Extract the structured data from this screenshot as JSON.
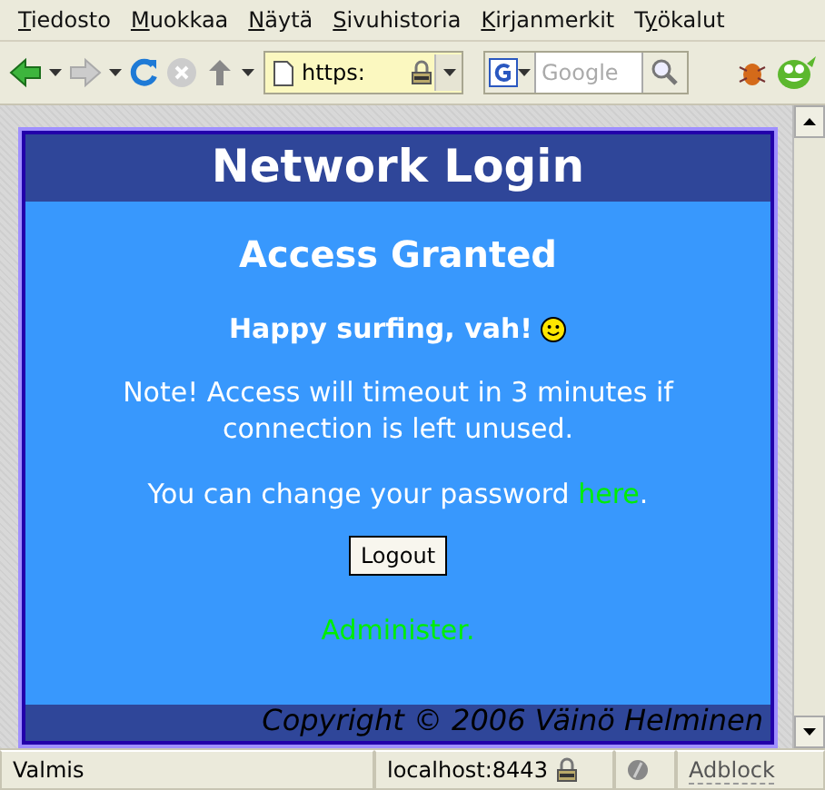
{
  "menu": [
    {
      "underlined": "T",
      "after": "iedosto"
    },
    {
      "underlined": "M",
      "after": "uokkaa"
    },
    {
      "underlined": "N",
      "after": "äytä"
    },
    {
      "underlined": "S",
      "after": "ivuhistoria"
    },
    {
      "underlined": "K",
      "after": "irjanmerkit"
    },
    {
      "before": "T",
      "underlined": "y",
      "after": "ökalut"
    }
  ],
  "toolbar": {
    "address": "https:",
    "search_placeholder": "Google"
  },
  "page": {
    "title": "Network Login",
    "heading": "Access Granted",
    "greeting": "Happy surfing, vah!",
    "note": "Note! Access will timeout in 3 minutes if connection is left unused.",
    "password_text": "You can change your password ",
    "password_link": "here",
    "password_end": ".",
    "logout": "Logout",
    "admin_link": "Administer.",
    "copyright": "Copyright © 2006 Väinö Helminen"
  },
  "status_bar": {
    "message": "Valmis",
    "host": "localhost:8443",
    "adblock": "Adblock"
  }
}
